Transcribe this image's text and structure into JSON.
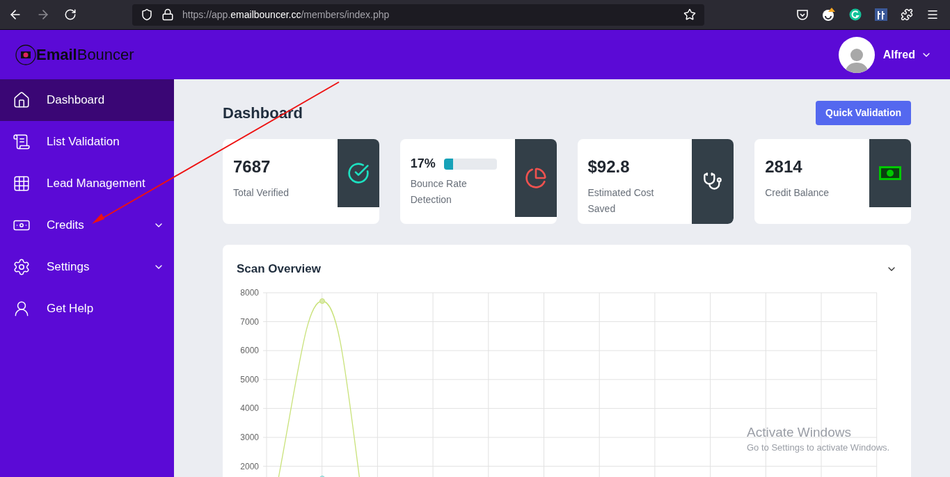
{
  "browser": {
    "url_prefix": "https://app.",
    "url_host": "emailbouncer.cc",
    "url_path": "/members/index.php",
    "forward_disabled": true
  },
  "header": {
    "logo": "**Email**Bouncer",
    "user": "Alfred"
  },
  "sidebar": {
    "items": [
      {
        "label": "Dashboard",
        "selected": true,
        "expandable": false
      },
      {
        "label": "List Validation",
        "selected": false,
        "expandable": false
      },
      {
        "label": "Lead Management",
        "selected": false,
        "expandable": false
      },
      {
        "label": "Credits",
        "selected": false,
        "expandable": true
      },
      {
        "label": "Settings",
        "selected": false,
        "expandable": true
      },
      {
        "label": "Get Help",
        "selected": false,
        "expandable": false
      }
    ]
  },
  "page": {
    "title": "Dashboard",
    "action": "Quick Validation"
  },
  "stats": [
    {
      "kind": "plain",
      "value": "7687",
      "label": "Total Verified"
    },
    {
      "kind": "progress",
      "value": "17%",
      "label": "Bounce Rate Detection",
      "level": 0.17
    },
    {
      "kind": "plain",
      "value": "$92.8",
      "label": "Estimated Cost Saved"
    },
    {
      "kind": "plain",
      "value": "2814",
      "label": "Credit Balance"
    }
  ],
  "chart_card": {
    "title": "Scan Overview",
    "y_axis_labels": [
      "8000",
      "7000",
      "6000",
      "5000",
      "4000",
      "3000",
      "2000"
    ]
  },
  "os_notice": {
    "title": "Activate Windows",
    "text": "Go to Settings to activate Windows."
  }
}
